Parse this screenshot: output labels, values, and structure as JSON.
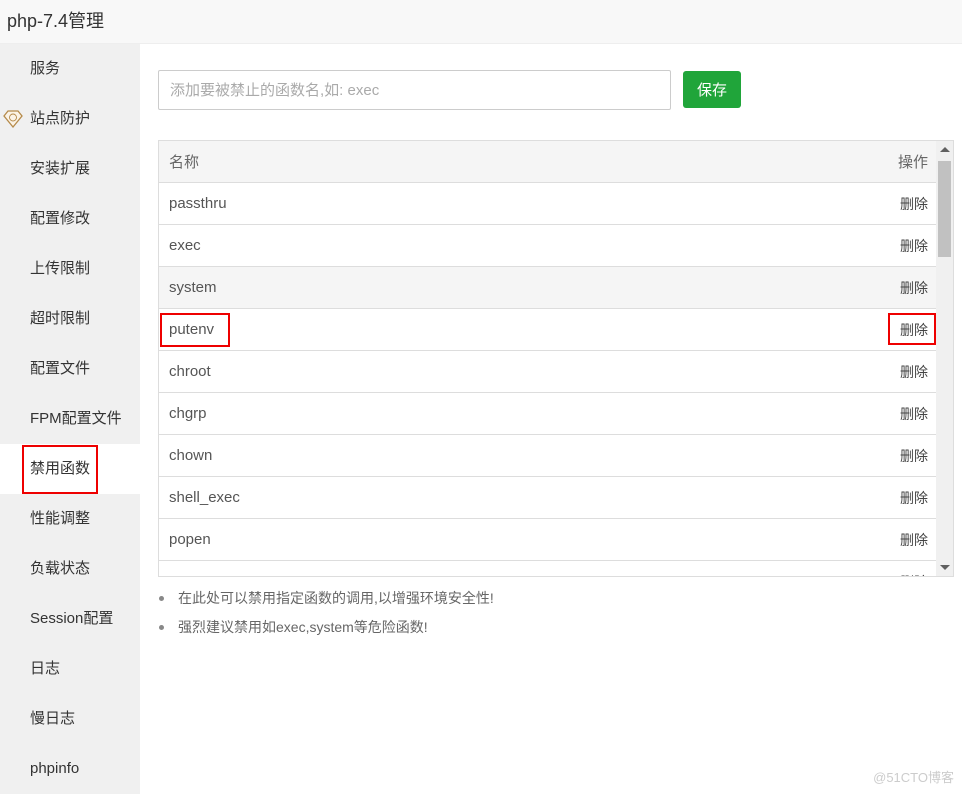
{
  "window": {
    "title": "php-7.4管理"
  },
  "sidebar": {
    "items": [
      {
        "label": "服务"
      },
      {
        "label": "站点防护",
        "icon": "enterprise-diamond-icon"
      },
      {
        "label": "安装扩展"
      },
      {
        "label": "配置修改"
      },
      {
        "label": "上传限制"
      },
      {
        "label": "超时限制"
      },
      {
        "label": "配置文件"
      },
      {
        "label": "FPM配置文件"
      },
      {
        "label": "禁用函数",
        "active": true
      },
      {
        "label": "性能调整"
      },
      {
        "label": "负载状态"
      },
      {
        "label": "Session配置"
      },
      {
        "label": "日志"
      },
      {
        "label": "慢日志"
      },
      {
        "label": "phpinfo"
      }
    ]
  },
  "form": {
    "placeholder": "添加要被禁止的函数名,如: exec",
    "save_label": "保存",
    "accent": "#20a53a"
  },
  "table": {
    "headers": {
      "name": "名称",
      "action": "操作"
    },
    "rows": [
      {
        "name": "passthru",
        "action": "删除"
      },
      {
        "name": "exec",
        "action": "删除"
      },
      {
        "name": "system",
        "action": "删除"
      },
      {
        "name": "putenv",
        "action": "删除"
      },
      {
        "name": "chroot",
        "action": "删除"
      },
      {
        "name": "chgrp",
        "action": "删除"
      },
      {
        "name": "chown",
        "action": "删除"
      },
      {
        "name": "shell_exec",
        "action": "删除"
      },
      {
        "name": "popen",
        "action": "删除"
      },
      {
        "name": "",
        "action": "删除"
      }
    ]
  },
  "tips": [
    "在此处可以禁用指定函数的调用,以增强环境安全性!",
    "强烈建议禁用如exec,system等危险函数!"
  ],
  "watermark": "@51CTO博客"
}
